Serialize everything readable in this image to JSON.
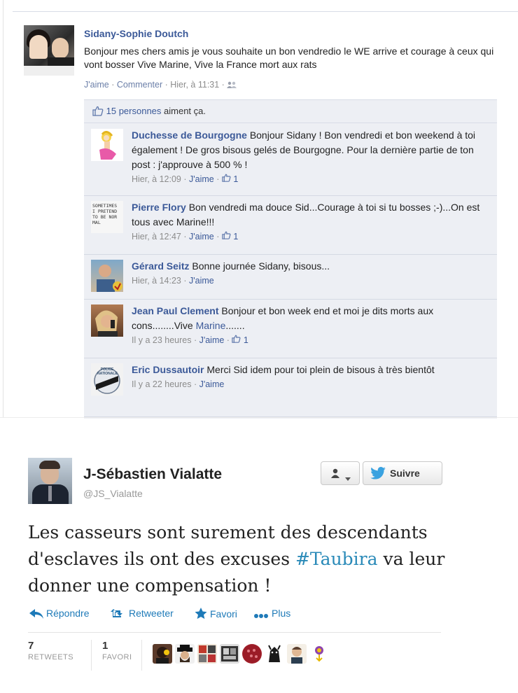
{
  "facebook": {
    "post": {
      "author": "Sidany-Sophie Doutch",
      "text": "Bonjour mes chers amis je vous souhaite un bon vendredio le WE arrive et courage à ceux qui vont bosser Vive Marine, Vive la France mort aux rats",
      "like_label": "J'aime",
      "comment_label": "Commenter",
      "timestamp": "Hier, à 11:31",
      "sep": " · "
    },
    "likes": {
      "count_text": "15 personnes",
      "suffix": " aiment ça."
    },
    "comments": [
      {
        "author": "Duchesse de Bourgogne",
        "text": "Bonjour Sidany ! Bon vendredi et bon weekend à toi également ! De gros bisous gelés de Bourgogne. Pour la dernière partie de ton post : j'approuve à 500 % !",
        "timestamp": "Hier, à 12:09",
        "like_label": "J'aime",
        "likes": "1"
      },
      {
        "author": "Pierre Flory",
        "text": "Bon vendredi ma douce Sid...Courage à toi si tu bosses ;-)...On est tous avec Marine!!!",
        "timestamp": "Hier, à 12:47",
        "like_label": "J'aime",
        "likes": "1"
      },
      {
        "author": "Gérard Seitz",
        "text": "Bonne journée Sidany, bisous...",
        "timestamp": "Hier, à 14:23",
        "like_label": "J'aime",
        "likes": ""
      },
      {
        "author": "Jean Paul Clement",
        "text_before": "Bonjour et bon week end et moi je dits morts aux cons........Vive ",
        "text_link": "Marine",
        "text_after": ".......",
        "timestamp": "Il y a 23 heures",
        "like_label": "J'aime",
        "likes": "1"
      },
      {
        "author": "Eric Dussautoir",
        "text": "Merci Sid idem pour toi plein de bisous à très bientôt",
        "timestamp": "Il y a 22 heures",
        "like_label": "J'aime",
        "likes": ""
      }
    ],
    "avatar_texts": {
      "pierre": "SOMETIMES I PRETEND TO BE NORMAL",
      "eric": "POLICE NATIONALE"
    }
  },
  "twitter": {
    "name": "J-Sébastien Vialatte",
    "handle": "@JS_Vialatte",
    "follow_label": "Suivre",
    "tweet_before": "Les casseurs sont surement des descendants d'esclaves ils ont des excuses ",
    "hashtag": "#Taubira",
    "tweet_after": " va leur donner une compensation !",
    "actions": {
      "reply": "Répondre",
      "retweet": "Retweeter",
      "favorite": "Favori",
      "more": "Plus"
    },
    "stats": {
      "retweets_count": "7",
      "retweets_label": "RETWEETS",
      "favorites_count": "1",
      "favorites_label": "FAVORI"
    }
  },
  "colors": {
    "fb_link": "#3b5998",
    "fb_comment_bg": "#edeff4",
    "tw_link": "#1e7ab8",
    "tw_hashtag": "#2a8ab8"
  }
}
